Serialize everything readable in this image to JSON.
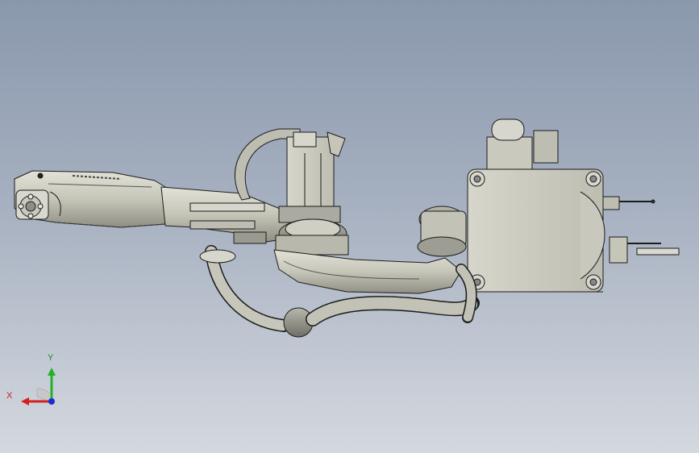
{
  "viewport": {
    "background_top": "#8a98ad",
    "background_bottom": "#d4d8df",
    "model_fill": "#c9c9bd",
    "model_edge": "#1c1c1c"
  },
  "triad": {
    "x_label": "X",
    "y_label": "Y",
    "x_color": "#d62020",
    "y_color": "#23b02a",
    "z_color": "#1a2fd0"
  }
}
